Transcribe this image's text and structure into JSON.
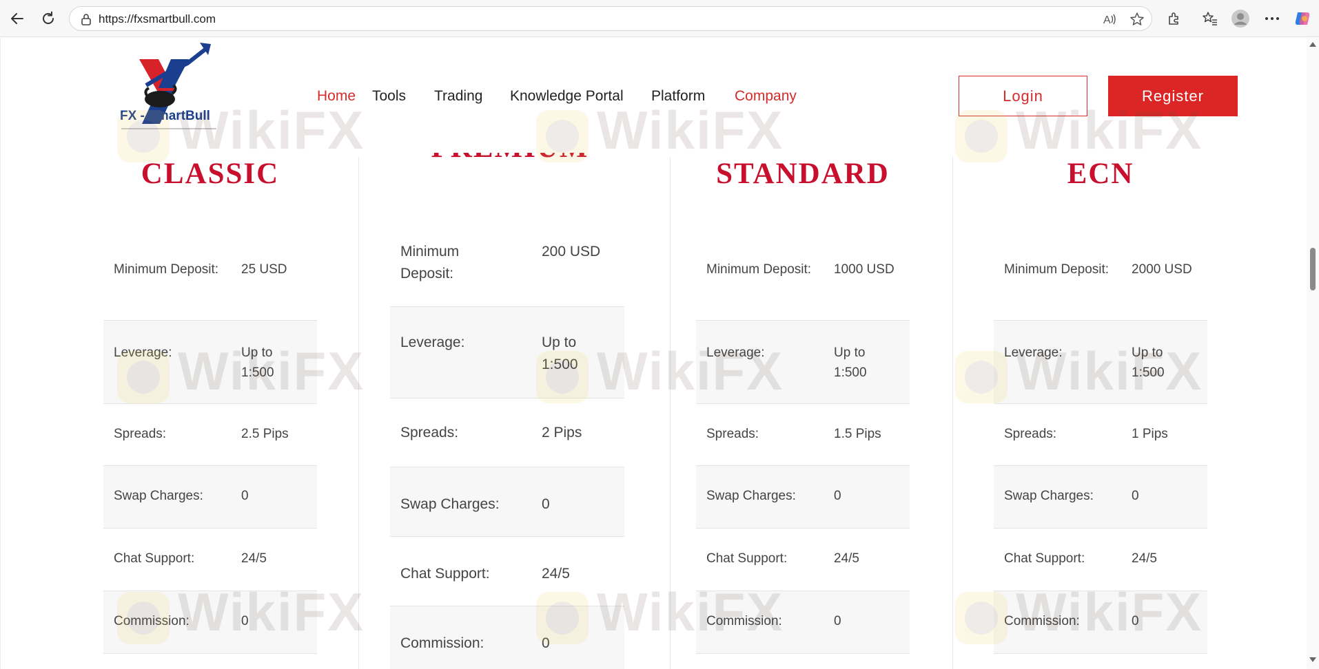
{
  "browser": {
    "url": "https://fxsmartbull.com"
  },
  "header": {
    "logo_text": "FX - SmartBull",
    "nav": [
      {
        "label": "Home",
        "active": true
      },
      {
        "label": "Tools",
        "active": false
      },
      {
        "label": "Trading",
        "active": false
      },
      {
        "label": "Knowledge Portal",
        "active": false
      },
      {
        "label": "Platform",
        "active": false
      },
      {
        "label": "Company",
        "active": true
      }
    ],
    "login_label": "Login",
    "register_label": "Register"
  },
  "watermark": "WikiFX",
  "accounts": [
    {
      "title": "CLASSIC",
      "rows": [
        {
          "label": "Minimum Deposit:",
          "value": "25 USD"
        },
        {
          "label": "Leverage:",
          "value": "Up to 1:500"
        },
        {
          "label": "Spreads:",
          "value": "2.5 Pips"
        },
        {
          "label": "Swap Charges:",
          "value": "0"
        },
        {
          "label": "Chat Support:",
          "value": "24/5"
        },
        {
          "label": "Commission:",
          "value": "0"
        }
      ]
    },
    {
      "title": "PREMIUM",
      "rows": [
        {
          "label": "Minimum Deposit:",
          "value": "200 USD"
        },
        {
          "label": "Leverage:",
          "value": "Up to 1:500"
        },
        {
          "label": "Spreads:",
          "value": "2 Pips"
        },
        {
          "label": "Swap Charges:",
          "value": "0"
        },
        {
          "label": "Chat Support:",
          "value": "24/5"
        },
        {
          "label": "Commission:",
          "value": "0"
        }
      ]
    },
    {
      "title": "STANDARD",
      "rows": [
        {
          "label": "Minimum Deposit:",
          "value": "1000 USD"
        },
        {
          "label": "Leverage:",
          "value": "Up to 1:500"
        },
        {
          "label": "Spreads:",
          "value": "1.5 Pips"
        },
        {
          "label": "Swap Charges:",
          "value": "0"
        },
        {
          "label": "Chat Support:",
          "value": "24/5"
        },
        {
          "label": "Commission:",
          "value": "0"
        }
      ]
    },
    {
      "title": "ECN",
      "rows": [
        {
          "label": "Minimum Deposit:",
          "value": "2000 USD"
        },
        {
          "label": "Leverage:",
          "value": "Up to 1:500"
        },
        {
          "label": "Spreads:",
          "value": "1 Pips"
        },
        {
          "label": "Swap Charges:",
          "value": "0"
        },
        {
          "label": "Chat Support:",
          "value": "24/5"
        },
        {
          "label": "Commission:",
          "value": "0"
        }
      ]
    }
  ]
}
